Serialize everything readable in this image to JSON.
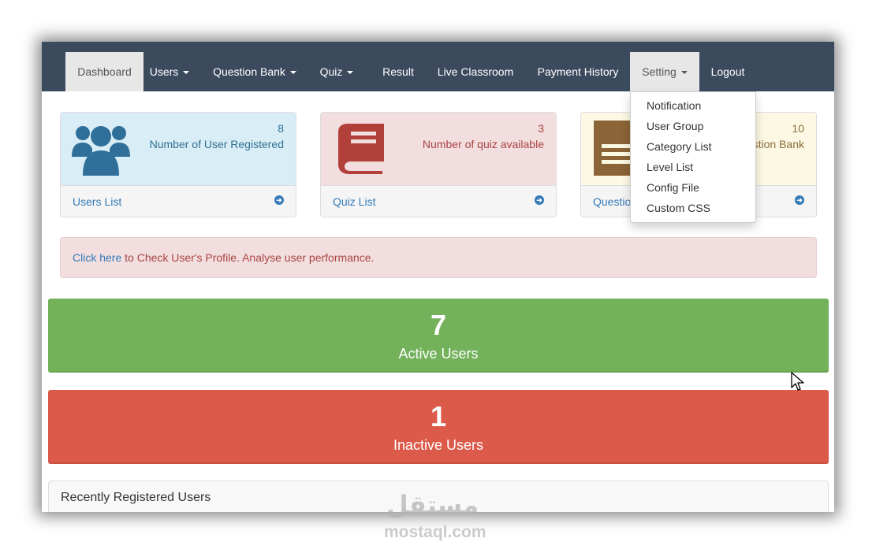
{
  "navbar": {
    "items": [
      {
        "label": "Dashboard",
        "active": true
      },
      {
        "label": "Users",
        "dropdown": true
      },
      {
        "label": "Question Bank",
        "dropdown": true
      },
      {
        "label": "Quiz",
        "dropdown": true
      },
      {
        "label": "Result"
      },
      {
        "label": "Live Classroom"
      },
      {
        "label": "Payment History"
      },
      {
        "label": "Setting",
        "dropdown": true,
        "open": true
      },
      {
        "label": "Logout"
      }
    ]
  },
  "setting_dropdown": {
    "items": [
      "Notification",
      "User Group",
      "Category List",
      "Level List",
      "Config File",
      "Custom CSS"
    ]
  },
  "stat_panels": [
    {
      "count": "8",
      "title": "Number of User Registered",
      "link": "Users List",
      "icon": "users-icon",
      "color": "#2f6f9a"
    },
    {
      "count": "3",
      "title": "Number of quiz available",
      "link": "Quiz List",
      "icon": "book-icon",
      "color": "#b2403a"
    },
    {
      "count": "10",
      "title": "stion Bank",
      "link": "Questio",
      "icon": "document-icon",
      "color": "#8b6437"
    }
  ],
  "alert": {
    "link": "Click here",
    "text": " to Check User's Profile. Analyse user performance."
  },
  "active_users": {
    "count": "7",
    "label": "Active Users",
    "color": "#73b15b"
  },
  "inactive_users": {
    "count": "1",
    "label": "Inactive Users",
    "color": "#dc5a4a"
  },
  "recent": {
    "title": "Recently Registered Users"
  },
  "watermark": {
    "arabic": "مستقل",
    "latin": "mostaql.com"
  }
}
